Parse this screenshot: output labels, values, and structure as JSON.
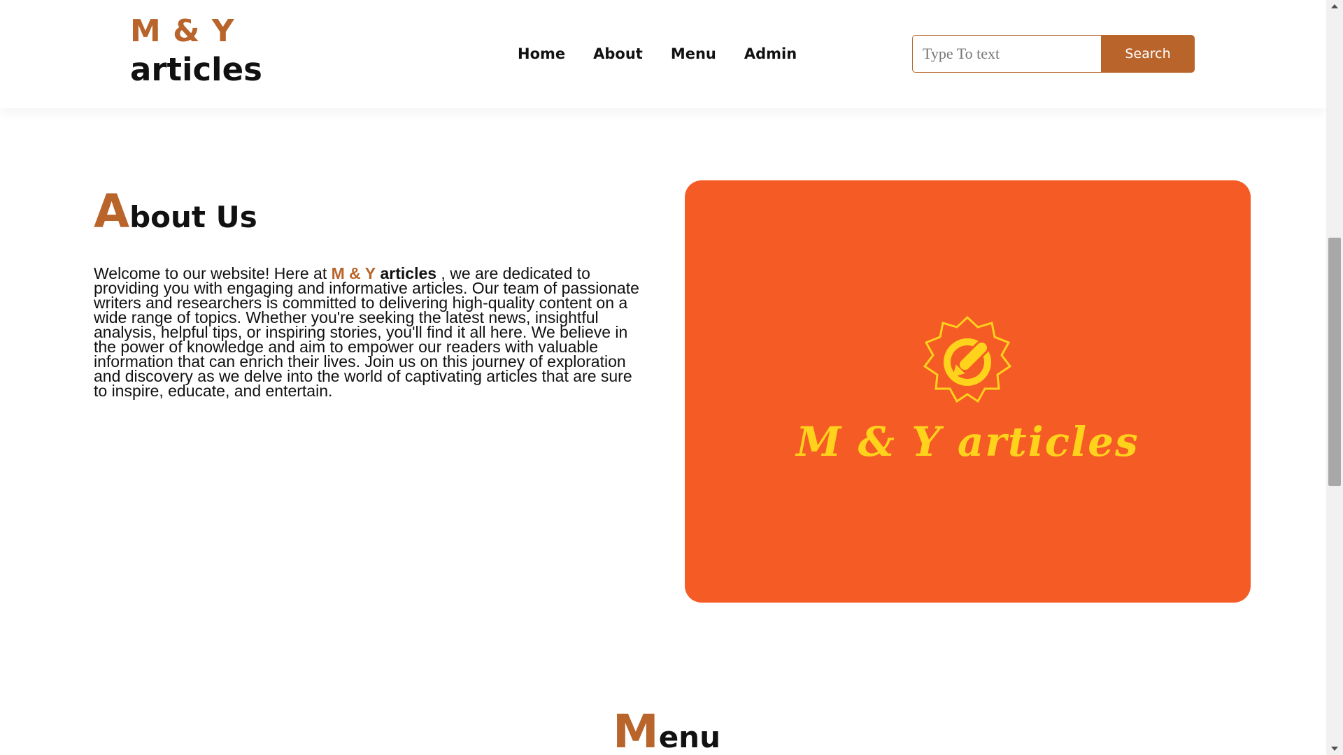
{
  "header": {
    "logo_top": "M & Y",
    "logo_bottom": "articles",
    "nav": [
      "Home",
      "About",
      "Menu",
      "Admin"
    ],
    "search_placeholder": "Type To text",
    "search_button": "Search"
  },
  "about": {
    "title_first": "A",
    "title_rest": "bout Us",
    "text_before": "Welcome to our website! Here at ",
    "brand_my": "M & Y",
    "brand_articles": "articles",
    "text_after": " , we are dedicated to providing you with engaging and informative articles. Our team of passionate writers and researchers is committed to delivering high-quality content on a wide range of topics. Whether you're seeking the latest news, insightful analysis, helpful tips, or inspiring stories, you'll find it all here. We believe in the power of knowledge and aim to empower our readers with valuable information that can enrich their lives. Join us on this journey of exploration and discovery as we delve into the world of captivating articles that are sure to inspire, educate, and entertain."
  },
  "hero": {
    "image_text": "M & Y articles",
    "emblem_icon": "rocket-gear-icon"
  },
  "menu_section": {
    "title_first": "M",
    "title_rest": "enu"
  },
  "colors": {
    "accent": "#b8642a",
    "hero_bg": "#f55b25",
    "hero_text": "#ffd21c"
  }
}
